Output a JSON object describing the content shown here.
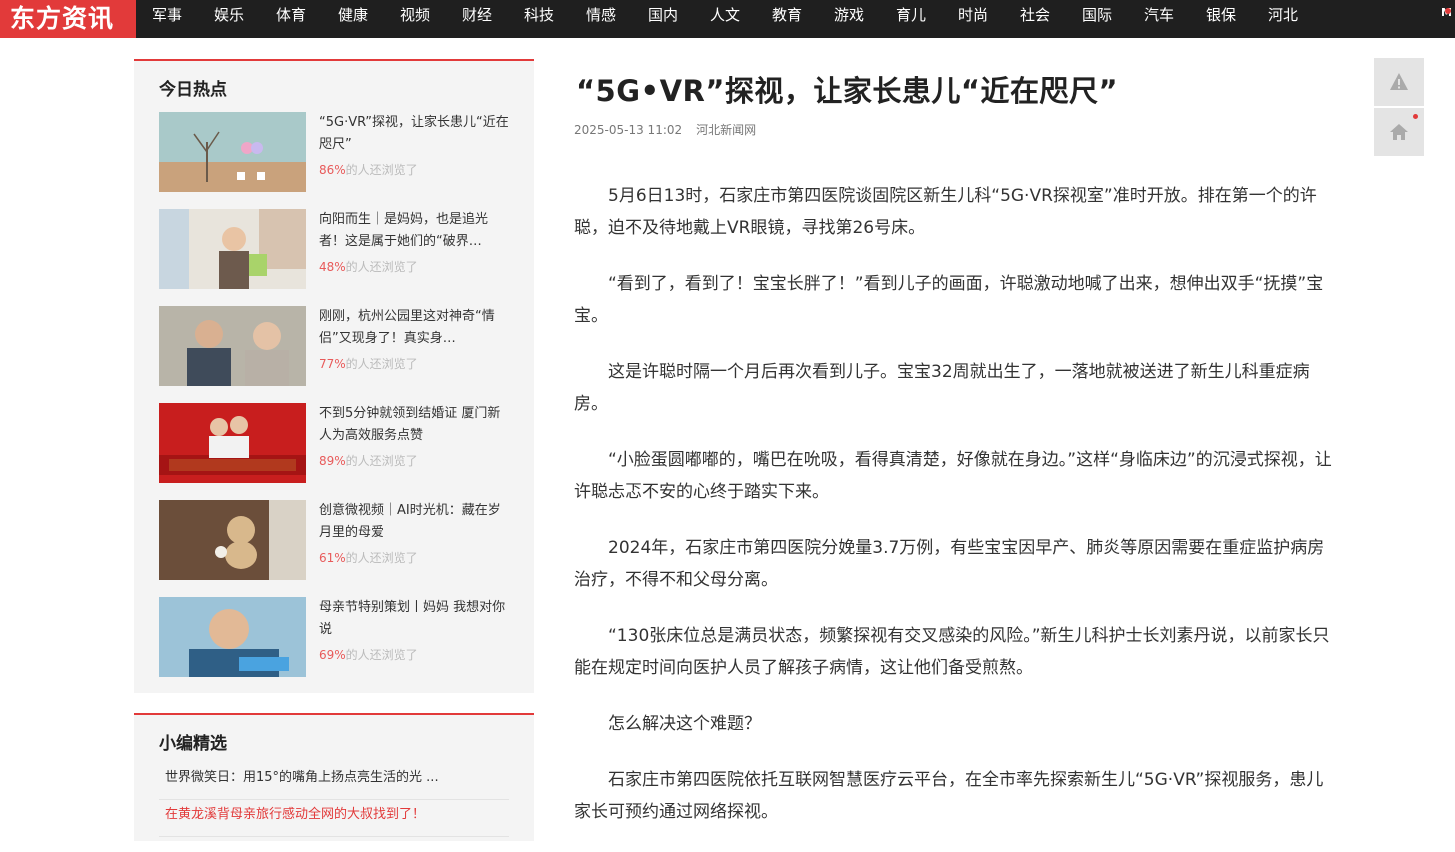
{
  "site": {
    "logo": "东方资讯"
  },
  "nav": {
    "items": [
      "军事",
      "娱乐",
      "体育",
      "健康",
      "视频",
      "财经",
      "科技",
      "情感",
      "国内",
      "人文",
      "教育",
      "游戏",
      "育儿",
      "时尚",
      "社会",
      "国际",
      "汽车",
      "银保",
      "河北"
    ]
  },
  "hot": {
    "title": "今日热点",
    "suffix": "的人还浏览了",
    "items": [
      {
        "text": "“5G·VR”探视，让家长患儿“近在咫尺”",
        "pct": "86%"
      },
      {
        "text": "向阳而生｜是妈妈，也是追光者！这是属于她们的“破界…",
        "pct": "48%"
      },
      {
        "text": "刚刚，杭州公园里这对神奇“情侣”又现身了！真实身…",
        "pct": "77%"
      },
      {
        "text": "不到5分钟就领到结婚证 厦门新人为高效服务点赞",
        "pct": "89%"
      },
      {
        "text": "创意微视频｜AI时光机：藏在岁月里的母爱",
        "pct": "61%"
      },
      {
        "text": "母亲节特别策划丨妈妈 我想对你说",
        "pct": "69%"
      }
    ]
  },
  "picks": {
    "title": "小编精选",
    "items": [
      {
        "text": "世界微笑日：用15°的嘴角上扬点亮生活的光 ..."
      },
      {
        "text": "在黄龙溪背母亲旅行感动全网的大叔找到了！"
      }
    ]
  },
  "article": {
    "title": "“5G•VR”探视，让家长患儿“近在咫尺”",
    "date": "2025-05-13 11:02",
    "source": "河北新闻网",
    "paragraphs": [
      "5月6日13时，石家庄市第四医院谈固院区新生儿科“5G·VR探视室”准时开放。排在第一个的许聪，迫不及待地戴上VR眼镜，寻找第26号床。",
      "“看到了，看到了！宝宝长胖了！”看到儿子的画面，许聪激动地喊了出来，想伸出双手“抚摸”宝宝。",
      "这是许聪时隔一个月后再次看到儿子。宝宝32周就出生了，一落地就被送进了新生儿科重症病房。",
      "“小脸蛋圆嘟嘟的，嘴巴在吮吸，看得真清楚，好像就在身边。”这样“身临床边”的沉浸式探视，让许聪忐忑不安的心终于踏实下来。",
      "2024年，石家庄市第四医院分娩量3.7万例，有些宝宝因早产、肺炎等原因需要在重症监护病房治疗，不得不和父母分离。",
      "“130张床位总是满员状态，频繁探视有交叉感染的风险。”新生儿科护士长刘素丹说，以前家长只能在规定时间向医护人员了解孩子病情，这让他们备受煎熬。",
      "怎么解决这个难题？",
      "石家庄市第四医院依托互联网智慧医疗云平台，在全市率先探索新生儿“5G·VR”探视服务，患儿家长可预约通过网络探视。"
    ]
  },
  "tools": {
    "warn_icon": "warning-icon",
    "home_icon": "home-icon"
  },
  "colors": {
    "accent": "#e23a3a",
    "topbar": "#1f1f1f",
    "panel": "#f4f4f4"
  }
}
